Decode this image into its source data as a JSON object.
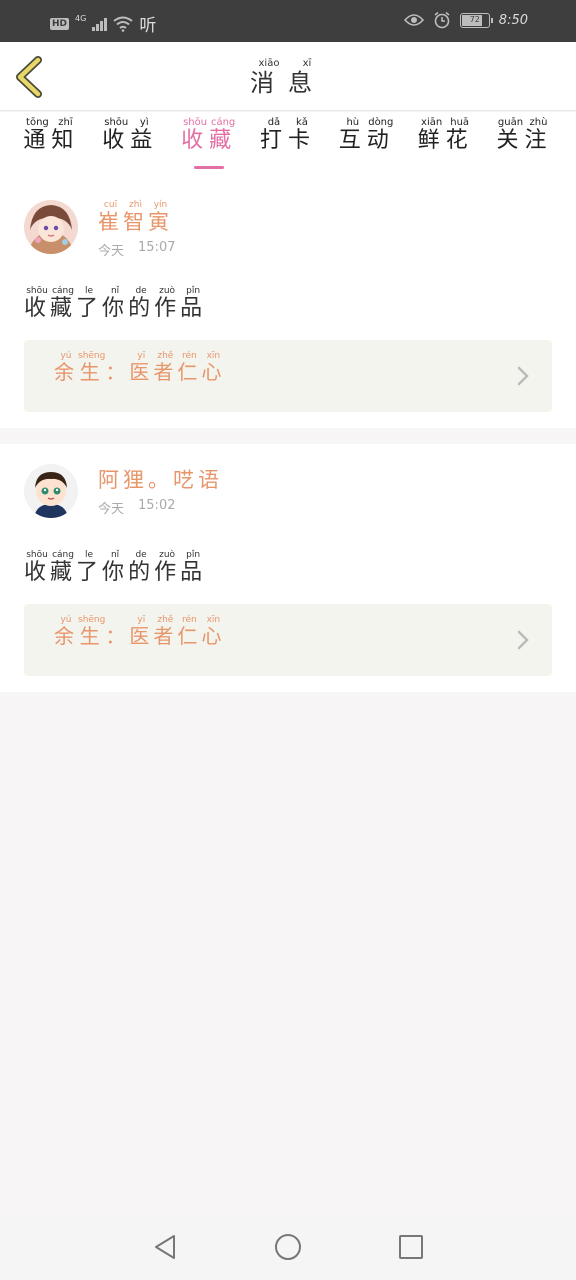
{
  "status_bar": {
    "hd": "HD",
    "network": "4G",
    "app_text": "听",
    "battery": "72",
    "time": "8:50",
    "icons": [
      "eye-icon",
      "alarm-icon",
      "battery-icon",
      "wifi-icon",
      "signal-icon"
    ]
  },
  "header": {
    "title": [
      {
        "char": "消",
        "pinyin": "xiāo"
      },
      {
        "char": "息",
        "pinyin": "xī"
      }
    ]
  },
  "tabs": [
    {
      "chars": [
        {
          "char": "通",
          "pinyin": "tōng"
        },
        {
          "char": "知",
          "pinyin": "zhī"
        }
      ],
      "active": false
    },
    {
      "chars": [
        {
          "char": "收",
          "pinyin": "shōu"
        },
        {
          "char": "益",
          "pinyin": "yì"
        }
      ],
      "active": false
    },
    {
      "chars": [
        {
          "char": "收",
          "pinyin": "shōu"
        },
        {
          "char": "藏",
          "pinyin": "cáng"
        }
      ],
      "active": true
    },
    {
      "chars": [
        {
          "char": "打",
          "pinyin": "dǎ"
        },
        {
          "char": "卡",
          "pinyin": "kǎ"
        }
      ],
      "active": false
    },
    {
      "chars": [
        {
          "char": "互",
          "pinyin": "hù"
        },
        {
          "char": "动",
          "pinyin": "dòng"
        }
      ],
      "active": false
    },
    {
      "chars": [
        {
          "char": "鲜",
          "pinyin": "xiān"
        },
        {
          "char": "花",
          "pinyin": "huā"
        }
      ],
      "active": false
    },
    {
      "chars": [
        {
          "char": "关",
          "pinyin": "guān"
        },
        {
          "char": "注",
          "pinyin": "zhù"
        }
      ],
      "active": false
    }
  ],
  "messages": [
    {
      "user": [
        {
          "char": "崔",
          "pinyin": "cuī"
        },
        {
          "char": "智",
          "pinyin": "zhì"
        },
        {
          "char": "寅",
          "pinyin": "yín"
        }
      ],
      "date": "今天",
      "time": "15:07",
      "action": [
        {
          "char": "收",
          "pinyin": "shōu"
        },
        {
          "char": "藏",
          "pinyin": "cáng"
        },
        {
          "char": "了",
          "pinyin": "le"
        },
        {
          "char": "你",
          "pinyin": "nǐ"
        },
        {
          "char": "的",
          "pinyin": "de"
        },
        {
          "char": "作",
          "pinyin": "zuò"
        },
        {
          "char": "品",
          "pinyin": "pǐn"
        }
      ],
      "work": [
        {
          "char": "余",
          "pinyin": "yú"
        },
        {
          "char": "生",
          "pinyin": "shēng"
        },
        {
          "char": "：",
          "pinyin": ""
        },
        {
          "char": "医",
          "pinyin": "yī"
        },
        {
          "char": "者",
          "pinyin": "zhě"
        },
        {
          "char": "仁",
          "pinyin": "rén"
        },
        {
          "char": "心",
          "pinyin": "xīn"
        }
      ]
    },
    {
      "user": [
        {
          "char": "阿",
          "pinyin": ""
        },
        {
          "char": "狸",
          "pinyin": ""
        },
        {
          "char": "。",
          "pinyin": ""
        },
        {
          "char": "呓",
          "pinyin": ""
        },
        {
          "char": "语",
          "pinyin": ""
        }
      ],
      "date": "今天",
      "time": "15:02",
      "action": [
        {
          "char": "收",
          "pinyin": "shōu"
        },
        {
          "char": "藏",
          "pinyin": "cáng"
        },
        {
          "char": "了",
          "pinyin": "le"
        },
        {
          "char": "你",
          "pinyin": "nǐ"
        },
        {
          "char": "的",
          "pinyin": "de"
        },
        {
          "char": "作",
          "pinyin": "zuò"
        },
        {
          "char": "品",
          "pinyin": "pǐn"
        }
      ],
      "work": [
        {
          "char": "余",
          "pinyin": "yú"
        },
        {
          "char": "生",
          "pinyin": "shēng"
        },
        {
          "char": "：",
          "pinyin": ""
        },
        {
          "char": "医",
          "pinyin": "yī"
        },
        {
          "char": "者",
          "pinyin": "zhě"
        },
        {
          "char": "仁",
          "pinyin": "rén"
        },
        {
          "char": "心",
          "pinyin": "xīn"
        }
      ]
    }
  ],
  "colors": {
    "accent": "#e36fa4",
    "name": "#e8956a",
    "back_arrow": "#e8d86a",
    "card_work_bg": "#f4f4ee"
  }
}
